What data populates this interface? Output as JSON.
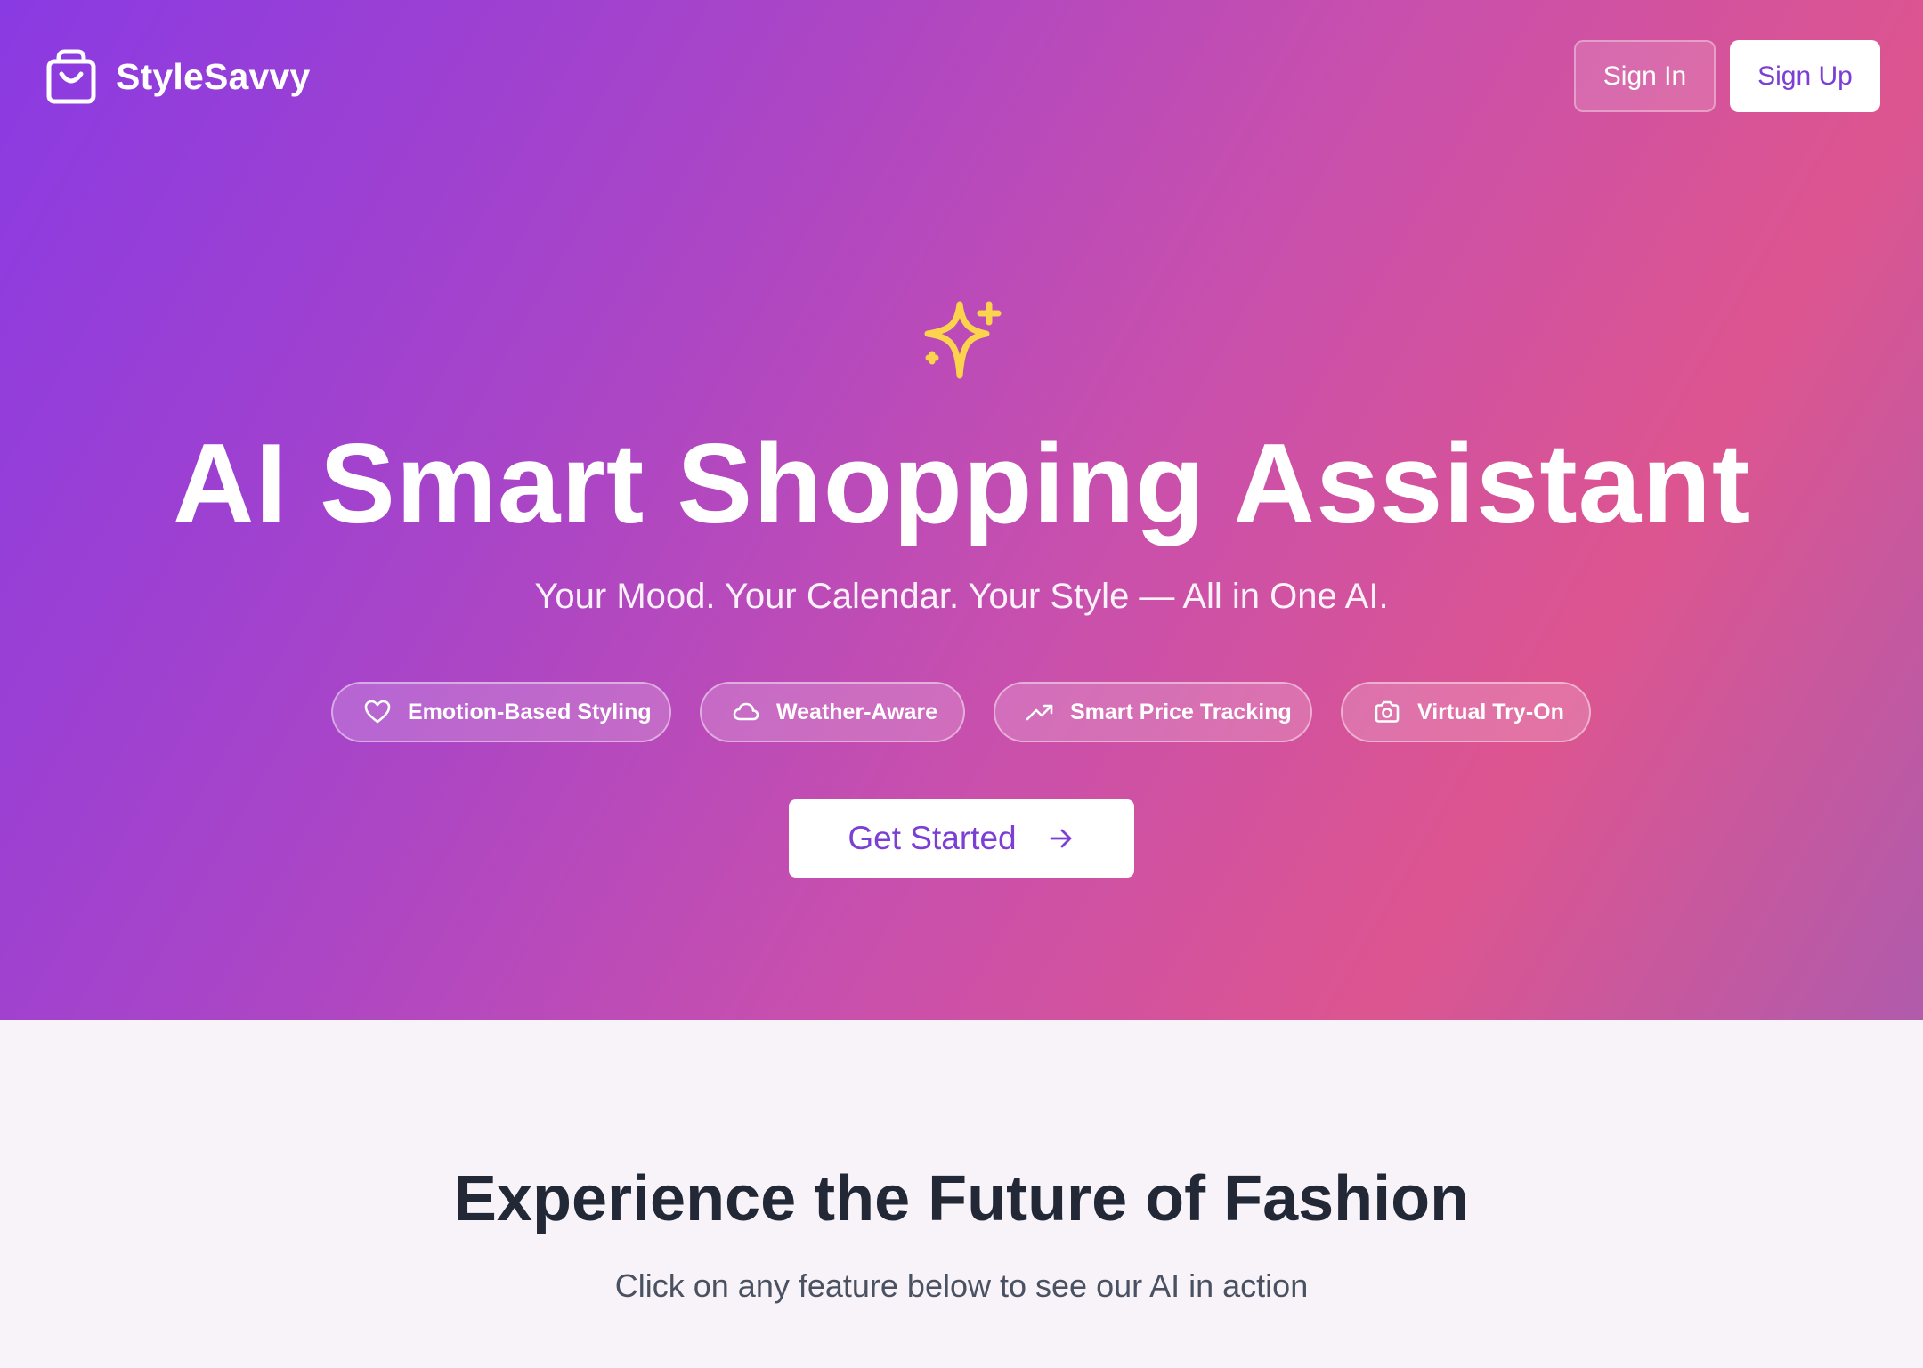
{
  "brand": {
    "name": "StyleSavvy",
    "icon": "shopping-bag-icon"
  },
  "nav": {
    "sign_in": "Sign In",
    "sign_up": "Sign Up"
  },
  "hero": {
    "icon": "sparkles-icon",
    "title": "AI Smart Shopping Assistant",
    "subtitle": "Your Mood. Your Calendar. Your Style — All in One AI.",
    "features": [
      {
        "label": "Emotion-Based Styling",
        "icon": "heart-icon"
      },
      {
        "label": "Weather-Aware",
        "icon": "cloud-icon"
      },
      {
        "label": "Smart Price Tracking",
        "icon": "trending-up-icon"
      },
      {
        "label": "Virtual Try-On",
        "icon": "camera-icon"
      }
    ],
    "cta": {
      "label": "Get Started",
      "icon": "arrow-right-icon"
    }
  },
  "section": {
    "title": "Experience the Future of Fashion",
    "subtitle": "Click on any feature below to see our AI in action"
  },
  "colors": {
    "gradient_start": "#8a3ae3",
    "gradient_end": "#dd5590",
    "accent_purple": "#7b3fd4",
    "sparkle_yellow": "#fcd34d"
  }
}
